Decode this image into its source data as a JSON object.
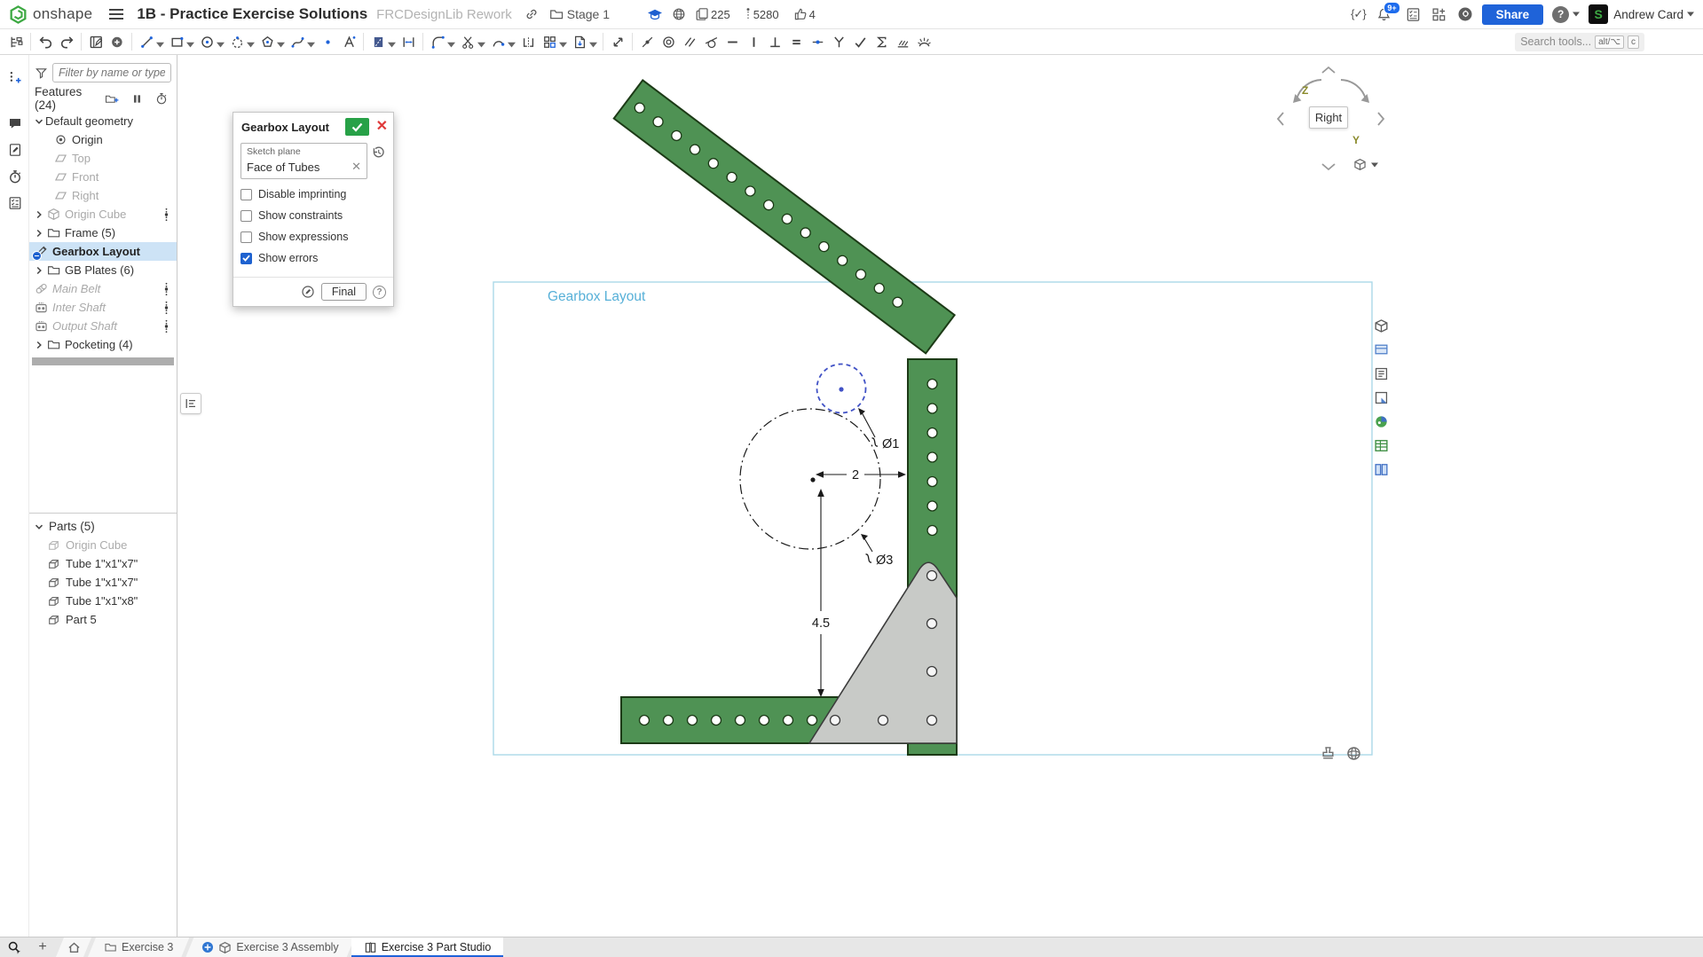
{
  "header": {
    "brand": "onshape",
    "title": "1B - Practice Exercise Solutions",
    "subtitle": "FRCDesignLib Rework",
    "folder": "Stage 1",
    "stat_copies": "225",
    "stat_views": "5280",
    "stat_likes": "4",
    "notif_badge": "9+",
    "share": "Share",
    "user": "Andrew Card"
  },
  "toolbar": {
    "search_placeholder": "Search tools...",
    "kbd1": "alt/⌥",
    "kbd2": "c",
    "tools": [
      "undo",
      "redo",
      "sketch",
      "insert-image",
      "line",
      "corner-rectangle",
      "circle",
      "construction-circle",
      "polygon",
      "spline",
      "point",
      "text",
      "construction",
      "dimension",
      "fillet",
      "trim",
      "use-project",
      "mirror",
      "pattern",
      "import-dxf-dwg",
      "transform",
      "coincident",
      "concentric",
      "parallel",
      "tangent",
      "horizontal",
      "vertical",
      "perpendicular",
      "equal",
      "midpoint",
      "pierce",
      "curvature-check",
      "sigma",
      "hatch",
      "curvature-comb"
    ]
  },
  "feature_panel": {
    "filter_placeholder": "Filter by name or type",
    "features_header": "Features (24)",
    "tree": [
      {
        "label": "Default geometry",
        "type": "group",
        "expanded": true
      },
      {
        "label": "Origin"
      },
      {
        "label": "Top",
        "muted": true
      },
      {
        "label": "Front",
        "muted": true
      },
      {
        "label": "Right",
        "muted": true
      },
      {
        "label": "Origin Cube",
        "muted": true
      },
      {
        "label": "Frame (5)"
      },
      {
        "label": "Gearbox Layout",
        "selected": true,
        "editing": true
      },
      {
        "label": "GB Plates (6)"
      },
      {
        "label": "Main Belt",
        "suppressed": true
      },
      {
        "label": "Inter Shaft",
        "suppressed": true
      },
      {
        "label": "Output Shaft",
        "suppressed": true
      },
      {
        "label": "Pocketing (4)"
      }
    ],
    "parts_header": "Parts (5)",
    "parts": [
      {
        "label": "Origin Cube",
        "muted": true
      },
      {
        "label": "Tube 1\"x1\"x7\""
      },
      {
        "label": "Tube 1\"x1\"x7\""
      },
      {
        "label": "Tube 1\"x1\"x8\""
      },
      {
        "label": "Part 5"
      }
    ]
  },
  "dialog": {
    "title": "Gearbox Layout",
    "plane_label": "Sketch plane",
    "plane_value": "Face of Tubes",
    "cb1": "Disable imprinting",
    "cb2": "Show constraints",
    "cb3": "Show expressions",
    "cb4": "Show errors",
    "cb1_checked": false,
    "cb2_checked": false,
    "cb3_checked": false,
    "cb4_checked": true,
    "final": "Final"
  },
  "canvas": {
    "sketch_label": "Gearbox Layout",
    "dim_width": "2",
    "dim_height": "4.5",
    "dim_d1": "Ø1",
    "dim_d3": "Ø3",
    "view_label": "Right",
    "axis_z": "Z",
    "axis_y": "Y"
  },
  "footer": {
    "tabs": [
      {
        "label": "Exercise 3"
      },
      {
        "label": "Exercise 3 Assembly"
      },
      {
        "label": "Exercise 3 Part Studio",
        "active": true
      }
    ]
  },
  "colors": {
    "accent_blue": "#1f63d9",
    "onshape_green": "#3da943",
    "tube_green": "#4f9254",
    "gusset_gray": "#c8cac7",
    "selection_row": "#cde3f6",
    "sketch_entity_blue": "#4152c6",
    "sketch_region_border": "#abd8e8",
    "sketch_label_blue": "#57b0d8"
  }
}
